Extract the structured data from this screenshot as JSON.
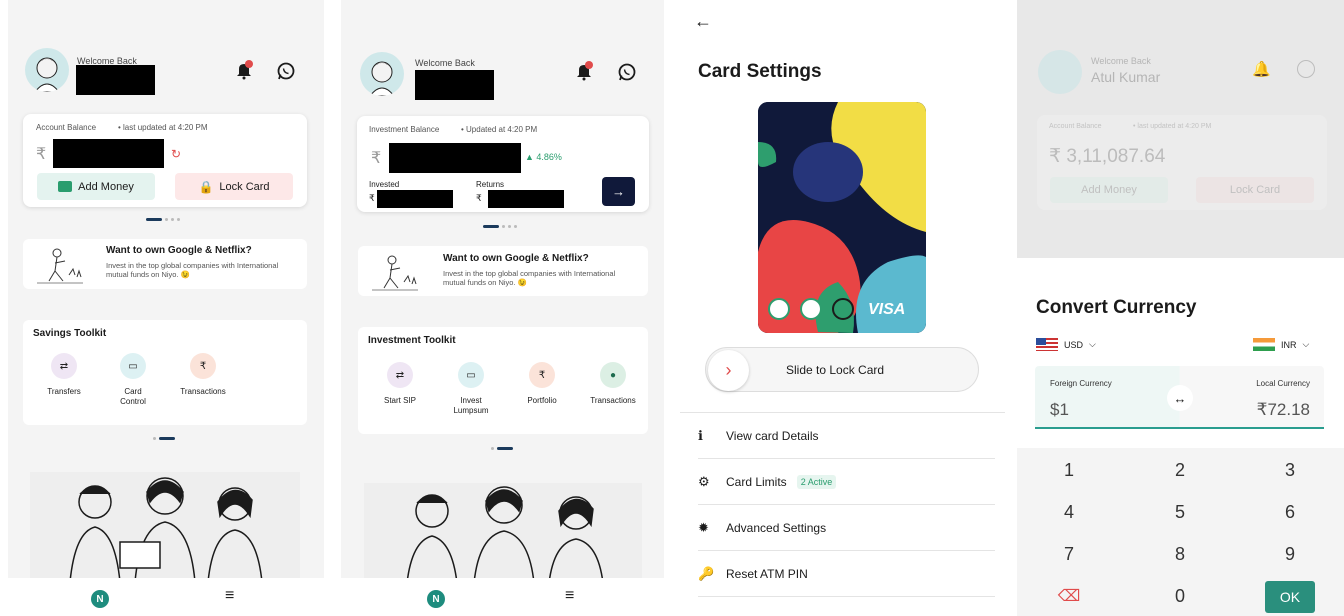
{
  "screen1": {
    "welcome": "Welcome Back",
    "balance_label": "Account Balance",
    "last_updated": "• last updated at 4:20 PM",
    "currency_symbol": "₹",
    "refresh_icon": "refresh-icon",
    "add_money": "Add Money",
    "lock_card": "Lock Card",
    "promo_title": "Want to own Google & Netflix?",
    "promo_sub": "Invest in the top global companies with International mutual funds on Niyo. 😉",
    "toolkit_title": "Savings Toolkit",
    "tools": [
      {
        "label": "Transfers",
        "icon": "⇄",
        "bg": "#efe6f4"
      },
      {
        "label": "Card Control",
        "icon": "▭",
        "bg": "#ddf1f3"
      },
      {
        "label": "Transactions",
        "icon": "₹",
        "bg": "#fbe3d9"
      }
    ],
    "nav_menu": "≡"
  },
  "screen2": {
    "welcome": "Welcome Back",
    "balance_label": "Investment Balance",
    "updated": "• Updated at 4:20 PM",
    "currency_symbol": "₹",
    "change": "▲ 4.86%",
    "invested_label": "Invested",
    "returns_label": "Returns",
    "promo_title": "Want to own Google & Netflix?",
    "promo_sub": "Invest in the top global companies with International mutual funds on Niyo. 😉",
    "toolkit_title": "Investment Toolkit",
    "tools": [
      {
        "label": "Start SIP",
        "icon": "⇄",
        "bg": "#efe6f4"
      },
      {
        "label": "Invest Lumpsum",
        "icon": "▭",
        "bg": "#ddf1f3"
      },
      {
        "label": "Portfolio",
        "icon": "₹",
        "bg": "#fbe3d9"
      },
      {
        "label": "Transactions",
        "icon": "●",
        "bg": "#dcefe4"
      }
    ],
    "nav_menu": "≡"
  },
  "screen3": {
    "back": "←",
    "title": "Card Settings",
    "card_brand": "VISA",
    "slide_label": "Slide to Lock Card",
    "rows": [
      {
        "label": "View card Details",
        "icon": "ℹ"
      },
      {
        "label": "Card Limits",
        "icon": "⚙"
      },
      {
        "label": "Advanced Settings",
        "icon": "✹"
      },
      {
        "label": "Reset ATM PIN",
        "icon": "🔑"
      }
    ],
    "limits_badge": "2 Active"
  },
  "screen4": {
    "bg_welcome": "Welcome Back",
    "bg_name": "Atul Kumar",
    "bg_balance_label": "Account Balance",
    "bg_last_updated": "• last updated at 4:20 PM",
    "bg_balance": "₹ 3,11,087.64",
    "bg_add_money": "Add Money",
    "bg_lock_card": "Lock Card",
    "title": "Convert Currency",
    "from_currency": "USD",
    "to_currency": "INR",
    "foreign_label": "Foreign Currency",
    "local_label": "Local Currency",
    "foreign_value": "$1",
    "local_value": "₹72.18",
    "swap_icon": "↔",
    "keys": [
      "1",
      "2",
      "3",
      "4",
      "5",
      "6",
      "7",
      "8",
      "9",
      "⌫",
      "0",
      "OK"
    ]
  },
  "colors": {
    "accent": "#2a8f7d",
    "navy": "#10193a",
    "green_change": "#2a9d6e",
    "red": "#e04b4b"
  }
}
